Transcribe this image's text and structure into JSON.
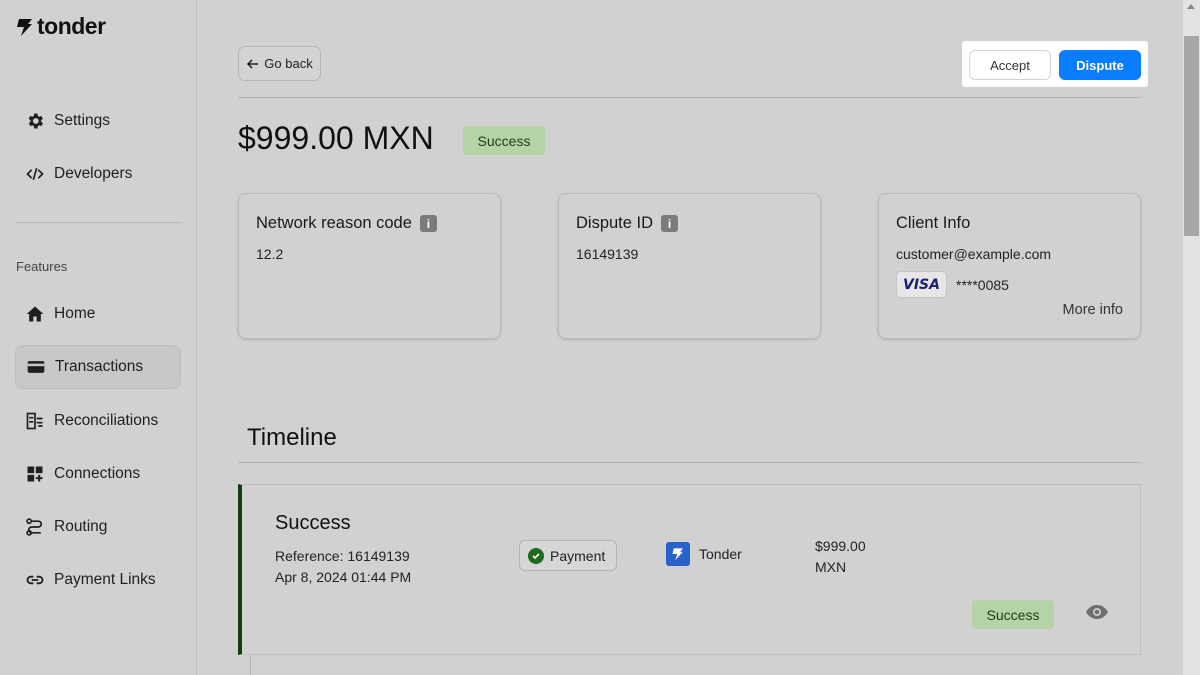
{
  "brand": {
    "name": "tonder"
  },
  "sidebar": {
    "top_items": [
      {
        "label": "Settings",
        "icon": "gear-icon"
      },
      {
        "label": "Developers",
        "icon": "code-icon"
      }
    ],
    "section_label": "Features",
    "items": [
      {
        "label": "Home",
        "icon": "home-icon"
      },
      {
        "label": "Transactions",
        "icon": "card-icon",
        "active": true
      },
      {
        "label": "Reconciliations",
        "icon": "reconcile-icon"
      },
      {
        "label": "Connections",
        "icon": "connections-icon"
      },
      {
        "label": "Routing",
        "icon": "routing-icon"
      },
      {
        "label": "Payment Links",
        "icon": "link-icon"
      }
    ]
  },
  "header": {
    "back_label": "Go back",
    "accept_label": "Accept",
    "dispute_label": "Dispute"
  },
  "summary": {
    "amount": "$999.00 MXN",
    "status": "Success"
  },
  "cards": {
    "network_reason": {
      "title": "Network reason code",
      "value": "12.2"
    },
    "dispute": {
      "title": "Dispute ID",
      "value": "16149139"
    },
    "client": {
      "title": "Client Info",
      "email": "customer@example.com",
      "card_brand": "VISA",
      "card_mask": "****0085",
      "more_info": "More info"
    }
  },
  "timeline": {
    "title": "Timeline",
    "events": [
      {
        "status": "Success",
        "reference": "Reference: 16149139",
        "date": "Apr 8, 2024 01:44 PM",
        "type": "Payment",
        "provider": "Tonder",
        "amount_value": "$999.00",
        "amount_currency": "MXN",
        "badge": "Success"
      }
    ]
  },
  "colors": {
    "primary": "#0a7cff",
    "success_bg": "#b6d3a8",
    "success_text": "#1c3d14",
    "timeline_accent": "#0f3f0f"
  }
}
